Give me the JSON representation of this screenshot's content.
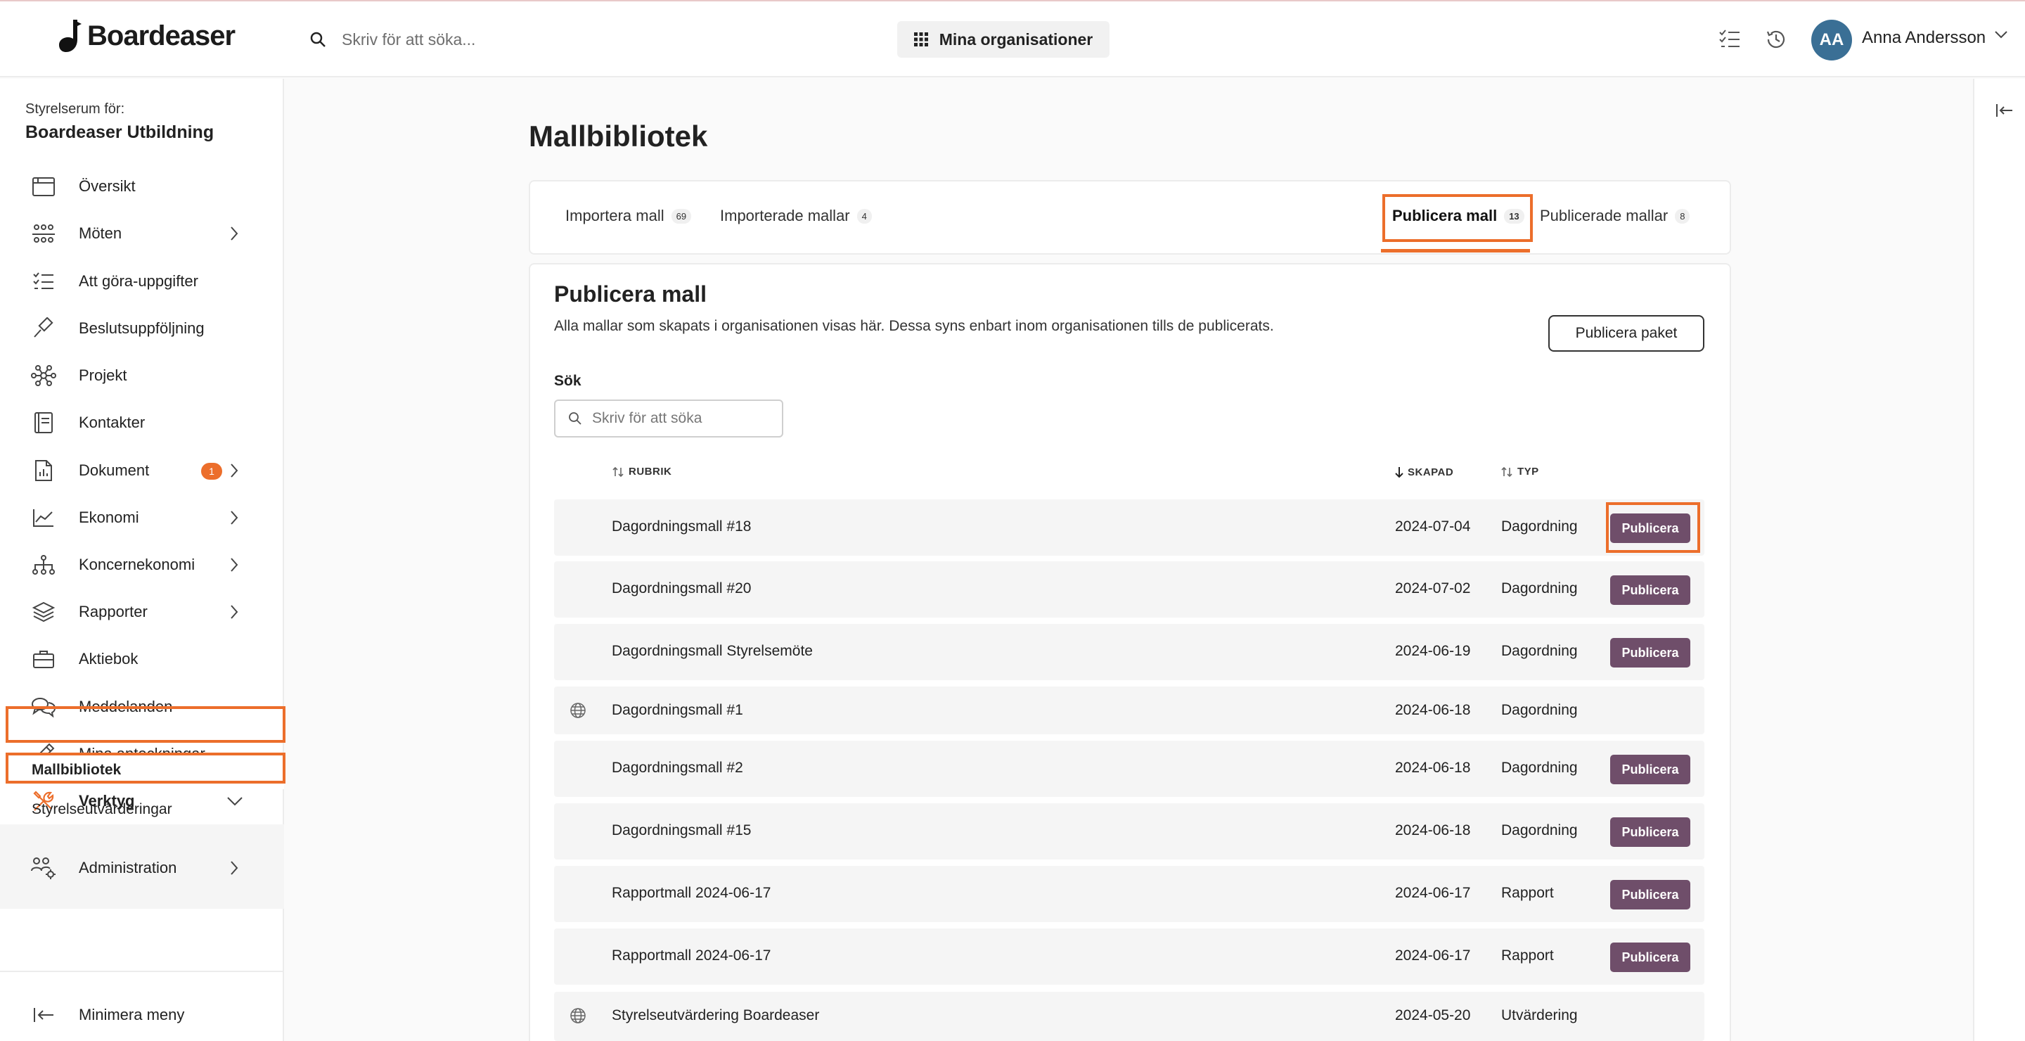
{
  "header": {
    "logo_text": "Boardeaser",
    "search_placeholder": "Skriv för att söka...",
    "org_button": "Mina organisationer",
    "avatar_initials": "AA",
    "user_name": "Anna Andersson"
  },
  "sidebar": {
    "room_label": "Styrelserum för:",
    "room_name": "Boardeaser Utbildning",
    "items": [
      {
        "label": "Översikt",
        "icon": "calendar-icon"
      },
      {
        "label": "Möten",
        "icon": "meeting-icon"
      },
      {
        "label": "Att göra-uppgifter",
        "icon": "checklist-icon"
      },
      {
        "label": "Beslutsuppföljning",
        "icon": "gavel-icon"
      },
      {
        "label": "Projekt",
        "icon": "network-icon"
      },
      {
        "label": "Kontakter",
        "icon": "book-icon"
      },
      {
        "label": "Dokument",
        "icon": "document-icon",
        "badge": "1"
      },
      {
        "label": "Ekonomi",
        "icon": "chart-icon"
      },
      {
        "label": "Koncernekonomi",
        "icon": "org-chart-icon"
      },
      {
        "label": "Rapporter",
        "icon": "layers-icon"
      },
      {
        "label": "Aktiebok",
        "icon": "briefcase-icon"
      },
      {
        "label": "Meddelanden",
        "icon": "chat-icon"
      },
      {
        "label": "Mina anteckningar",
        "icon": "pencil-icon"
      },
      {
        "label": "Verktyg",
        "icon": "tools-icon"
      },
      {
        "label": "Administration",
        "icon": "users-gear-icon"
      }
    ],
    "sub_items": [
      "Mallbibliotek",
      "Styrelseutvärderingar"
    ],
    "minimize": "Minimera meny"
  },
  "main": {
    "title": "Mallbibliotek",
    "tabs": [
      {
        "label": "Importera mall",
        "count": "69"
      },
      {
        "label": "Importerade mallar",
        "count": "4"
      },
      {
        "label": "Publicera mall",
        "count": "13"
      },
      {
        "label": "Publicerade mallar",
        "count": "8"
      }
    ],
    "section_title": "Publicera mall",
    "section_desc": "Alla mallar som skapats i organisationen visas här. Dessa syns enbart inom organisationen tills de publicerats.",
    "package_button": "Publicera paket",
    "search_label": "Sök",
    "search_placeholder": "Skriv för att söka",
    "columns": {
      "title": "RUBRIK",
      "created": "SKAPAD",
      "type": "TYP"
    },
    "publish_label": "Publicera",
    "rows": [
      {
        "name": "Dagordningsmall #18",
        "date": "2024-07-04",
        "type": "Dagordning",
        "published": false
      },
      {
        "name": "Dagordningsmall #20",
        "date": "2024-07-02",
        "type": "Dagordning",
        "published": false
      },
      {
        "name": "Dagordningsmall Styrelsemöte",
        "date": "2024-06-19",
        "type": "Dagordning",
        "published": false
      },
      {
        "name": "Dagordningsmall #1",
        "date": "2024-06-18",
        "type": "Dagordning",
        "published": true
      },
      {
        "name": "Dagordningsmall #2",
        "date": "2024-06-18",
        "type": "Dagordning",
        "published": false
      },
      {
        "name": "Dagordningsmall #15",
        "date": "2024-06-18",
        "type": "Dagordning",
        "published": false
      },
      {
        "name": "Rapportmall 2024-06-17",
        "date": "2024-06-17",
        "type": "Rapport",
        "published": false
      },
      {
        "name": "Rapportmall 2024-06-17",
        "date": "2024-06-17",
        "type": "Rapport",
        "published": false
      },
      {
        "name": "Styrelseutvärdering Boardeaser",
        "date": "2024-05-20",
        "type": "Utvärdering",
        "published": true
      }
    ]
  },
  "colors": {
    "accent": "#ec6e2b",
    "publish": "#6f4e6a",
    "avatar": "#3a6f95"
  }
}
